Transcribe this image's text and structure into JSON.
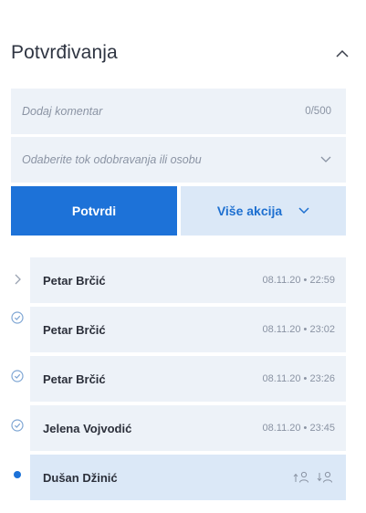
{
  "panel": {
    "title": "Potvrđivanja",
    "comment": {
      "placeholder": "Dodaj komentar",
      "counter": "0/500"
    },
    "flow_select": {
      "placeholder": "Odaberite tok odobravanja ili osobu"
    },
    "confirm_button": "Potvrdi",
    "more_actions_button": "Više akcija"
  },
  "approvals": [
    {
      "name": "Petar Brčić",
      "time": "08.11.20 • 22:59",
      "status": "expandable"
    },
    {
      "name": "Petar Brčić",
      "time": "08.11.20 • 23:02",
      "status": "approved"
    },
    {
      "name": "Petar Brčić",
      "time": "08.11.20 • 23:26",
      "status": "approved"
    },
    {
      "name": "Jelena Vojvodić",
      "time": "08.11.20 • 23:45",
      "status": "approved"
    },
    {
      "name": "Dušan Džinić",
      "status": "current"
    }
  ],
  "colors": {
    "primary": "#1d72d8",
    "field_bg": "#edf2f8",
    "active_bg": "#dbe8f7",
    "muted": "#8a93a3"
  }
}
